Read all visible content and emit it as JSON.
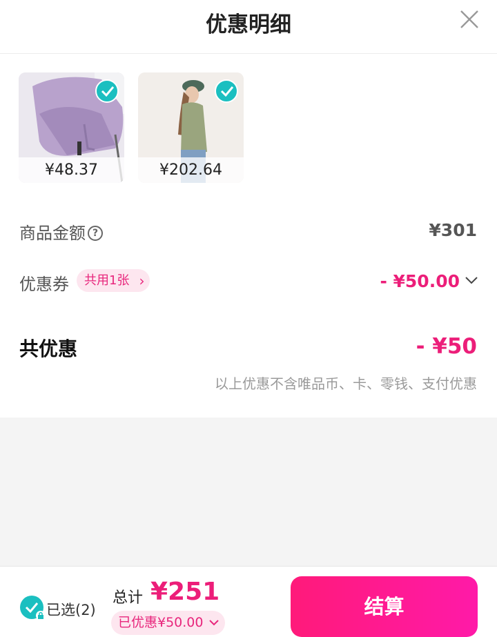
{
  "header": {
    "title": "优惠明细"
  },
  "products": [
    {
      "price": "¥48.37",
      "selected": true
    },
    {
      "price": "¥202.64",
      "selected": true
    }
  ],
  "rows": {
    "goods_amount": {
      "label": "商品金额",
      "help": "?",
      "value": "¥301"
    },
    "coupon": {
      "label": "优惠券",
      "badge": "共用1张",
      "value": "- ¥50.00"
    }
  },
  "total": {
    "label": "共优惠",
    "value": "- ¥50",
    "note": "以上优惠不含唯品币、卡、零钱、支付优惠"
  },
  "footer": {
    "selected": "已选(2)",
    "sum_label": "总计",
    "sum_value": "¥251",
    "saved": "已优惠¥50.00",
    "pay_label": "结算"
  },
  "colors": {
    "accent": "#ec1e79",
    "check": "#1bbfc0"
  },
  "icons": [
    "close-icon",
    "check-icon",
    "help-icon",
    "chevron-right-icon",
    "chevron-down-icon",
    "lock-icon"
  ]
}
